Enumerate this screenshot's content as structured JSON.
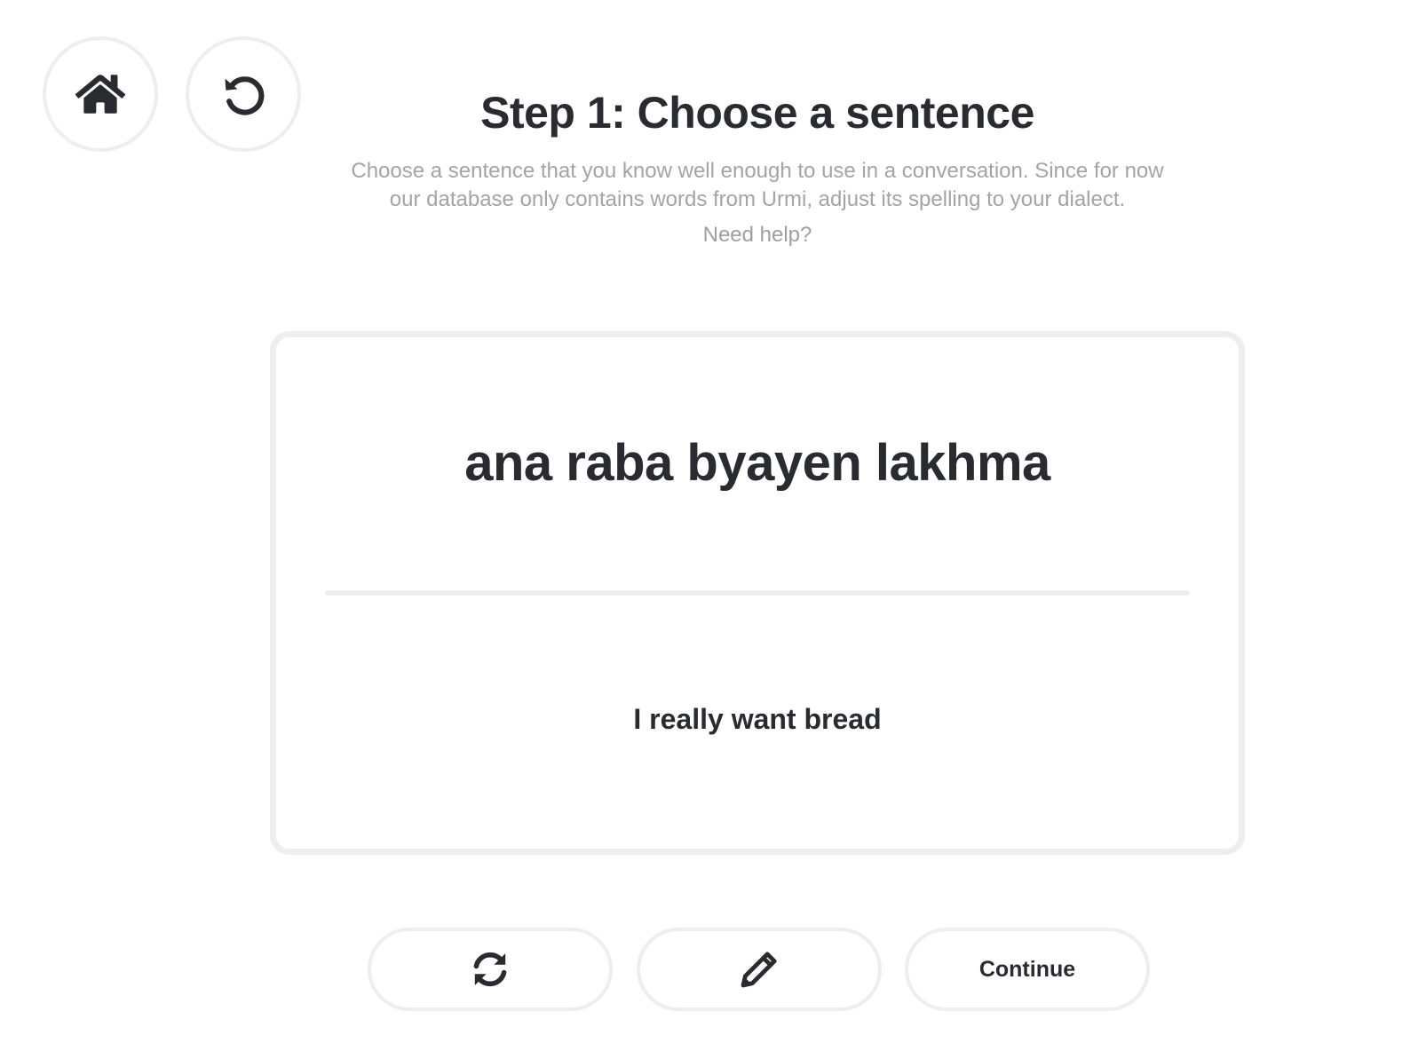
{
  "nav": {
    "home_icon": "home-icon",
    "reset_icon": "undo-icon"
  },
  "header": {
    "title": "Step 1: Choose a sentence",
    "subtitle": "Choose a sentence that you know well enough to use in a conversation. Since for now our database only contains words from Urmi, adjust its spelling to your dialect.",
    "help_link": "Need help?"
  },
  "card": {
    "sentence": "ana raba byayen lakhma",
    "translation": "I really want bread"
  },
  "actions": {
    "refresh_icon": "refresh-icon",
    "edit_icon": "pencil-icon",
    "continue_label": "Continue"
  },
  "colors": {
    "text": "#2a2b30",
    "muted": "#a4a4a8",
    "border": "#eeeeee",
    "background": "#ffffff"
  }
}
